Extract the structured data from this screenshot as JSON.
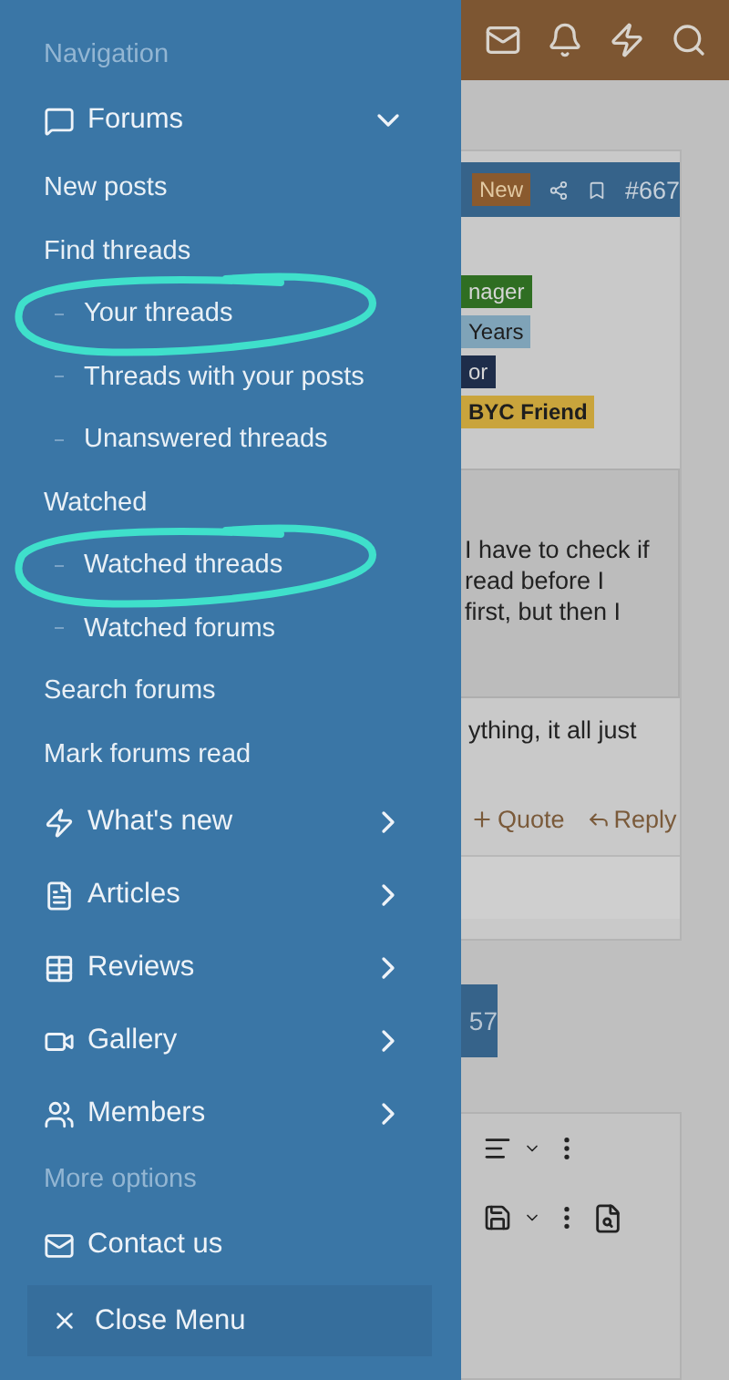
{
  "drawer": {
    "items": [
      {
        "kind": "heading",
        "label": "Navigation"
      },
      {
        "kind": "main",
        "label": "Forums",
        "expanded": true
      },
      {
        "kind": "link",
        "label": "New posts"
      },
      {
        "kind": "link",
        "label": "Find threads"
      },
      {
        "kind": "sub",
        "label": "Your threads",
        "highlighted": true
      },
      {
        "kind": "sub",
        "label": "Threads with your posts",
        "highlighted": false
      },
      {
        "kind": "sub",
        "label": "Unanswered threads",
        "highlighted": false
      },
      {
        "kind": "link",
        "label": "Watched"
      },
      {
        "kind": "sub",
        "label": "Watched threads",
        "highlighted": true
      },
      {
        "kind": "sub",
        "label": "Watched forums",
        "highlighted": false
      },
      {
        "kind": "link",
        "label": "Search forums"
      },
      {
        "kind": "link",
        "label": "Mark forums read"
      },
      {
        "kind": "main",
        "label": "What's new",
        "expanded": false
      },
      {
        "kind": "main",
        "label": "Articles",
        "expanded": false
      },
      {
        "kind": "main",
        "label": "Reviews",
        "expanded": false
      },
      {
        "kind": "main",
        "label": "Gallery",
        "expanded": false
      },
      {
        "kind": "main",
        "label": "Members",
        "expanded": false
      },
      {
        "kind": "heading",
        "label": "More options"
      },
      {
        "kind": "plain",
        "label": "Contact us"
      }
    ],
    "close_button": "Close Menu"
  },
  "page": {
    "post_header": {
      "badge": "New",
      "number": "#667"
    },
    "user_badges": [
      {
        "label": "nager",
        "color": "#2f6e22"
      },
      {
        "label": "Years",
        "color": "#7fa3b8"
      },
      {
        "label": "or",
        "color": "#1e2d4a"
      },
      {
        "label": "BYC Friend",
        "color": "#c9a43c"
      }
    ],
    "quote_lines": [
      "I have to check if",
      "read before I",
      "first, but then I"
    ],
    "body_line": "ything, it all just",
    "actions": [
      "Quote",
      "Reply"
    ],
    "page_button": "57"
  }
}
